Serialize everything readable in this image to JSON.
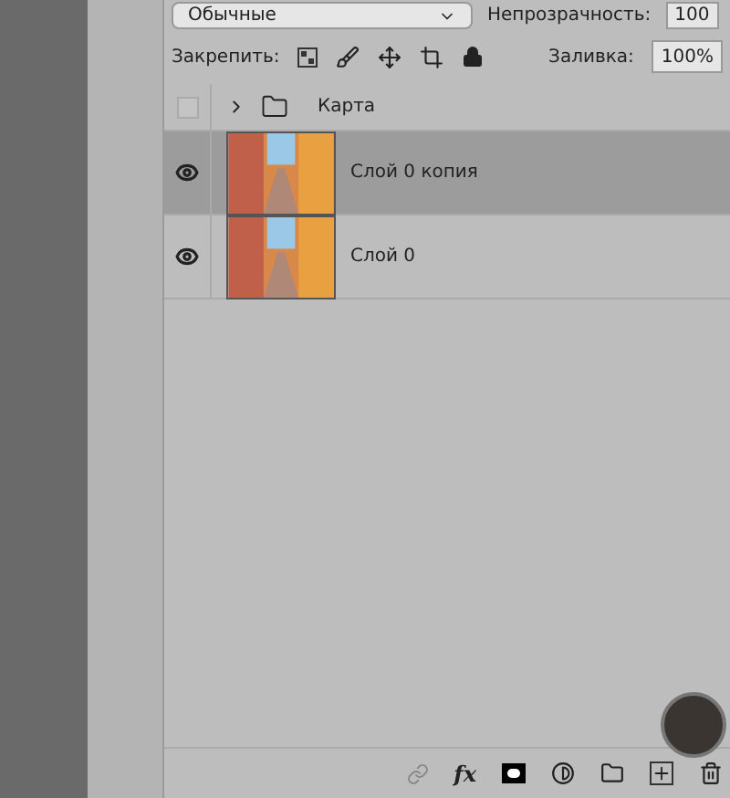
{
  "top_bar": {
    "blend_mode": "Обычные",
    "opacity_label": "Непрозрачность:",
    "opacity_value": "100"
  },
  "lock_row": {
    "label": "Закрепить:",
    "fill_label": "Заливка:",
    "fill_value": "100%"
  },
  "toolbar": {
    "fx_label": "fx"
  },
  "layers": [
    {
      "kind": "group",
      "name": "Карта",
      "visible": false,
      "expanded": false,
      "selected": false
    },
    {
      "kind": "layer",
      "name": "Слой 0 копия",
      "visible": true,
      "selected": true
    },
    {
      "kind": "layer",
      "name": "Слой 0",
      "visible": true,
      "selected": false
    }
  ]
}
